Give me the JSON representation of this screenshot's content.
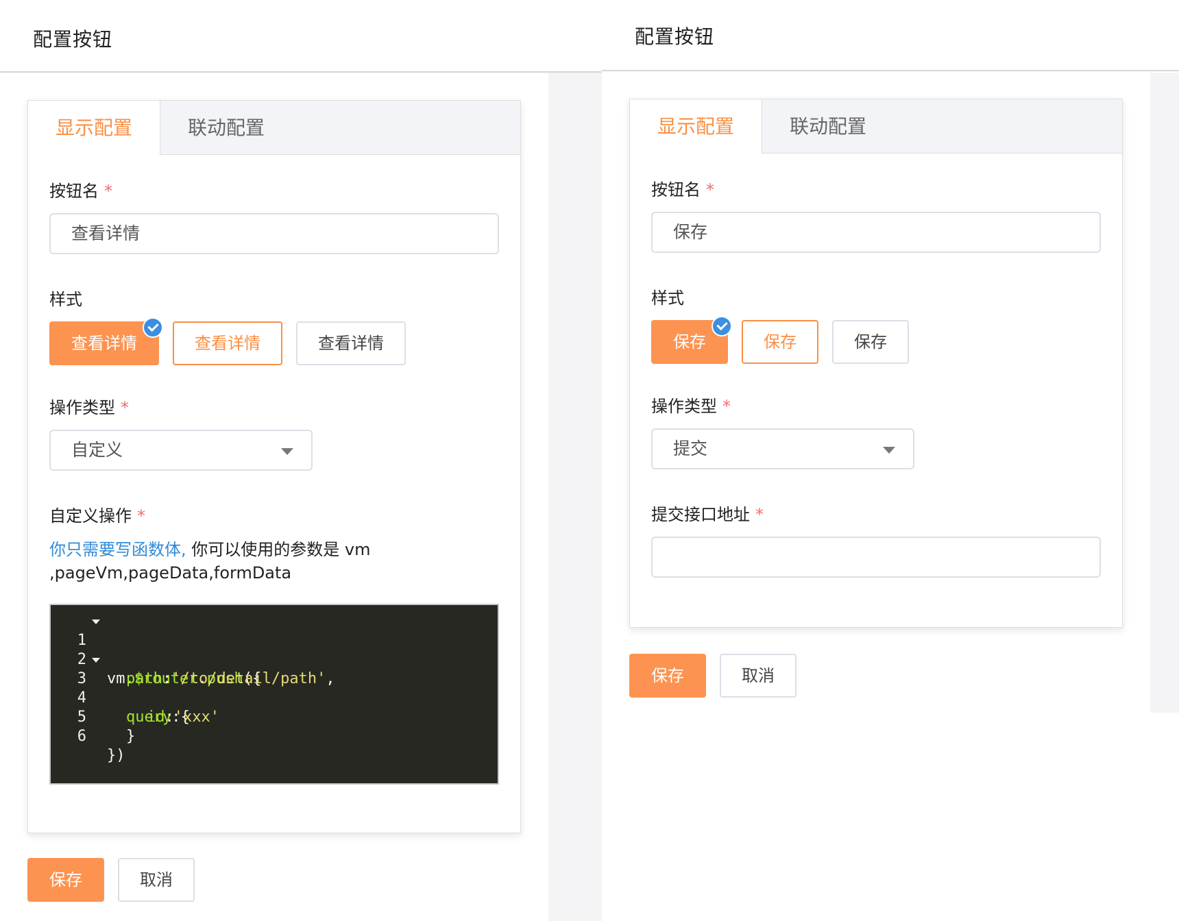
{
  "left_panel": {
    "title": "配置按钮",
    "tabs": [
      {
        "label": "显示配置"
      },
      {
        "label": "联动配置"
      }
    ],
    "button_name": {
      "label": "按钮名",
      "required": "*",
      "value": "查看详情"
    },
    "style": {
      "label": "样式",
      "options": [
        {
          "label": "查看详情"
        },
        {
          "label": "查看详情"
        },
        {
          "label": "查看详情"
        }
      ]
    },
    "operation_type": {
      "label": "操作类型",
      "required": "*",
      "value": "自定义"
    },
    "custom_operation": {
      "label": "自定义操作",
      "required": "*",
      "hint_link": "你只需要写函数体,",
      "hint_text": "你可以使用的参数是 vm ,pageVm,pageData,formData"
    },
    "code": {
      "lines": [
        {
          "n": "1",
          "t1": "vm.",
          "t2": "$router",
          "t3": ".",
          "t4": "push",
          "t5": "({"
        },
        {
          "n": "2",
          "key": "path",
          "sep": ":",
          "str": "'/to/detail/path'",
          "end": ","
        },
        {
          "n": "3",
          "key": "query",
          "sep": ":",
          "end": "{"
        },
        {
          "n": "4",
          "key": "id",
          "sep": ":",
          "str": "'xxx'"
        },
        {
          "n": "5",
          "text": "}"
        },
        {
          "n": "6",
          "text": "})"
        }
      ]
    },
    "actions": {
      "save": "保存",
      "cancel": "取消"
    }
  },
  "right_panel": {
    "title": "配置按钮",
    "tabs": [
      {
        "label": "显示配置"
      },
      {
        "label": "联动配置"
      }
    ],
    "button_name": {
      "label": "按钮名",
      "required": "*",
      "value": "保存"
    },
    "style": {
      "label": "样式",
      "options": [
        {
          "label": "保存"
        },
        {
          "label": "保存"
        },
        {
          "label": "保存"
        }
      ]
    },
    "operation_type": {
      "label": "操作类型",
      "required": "*",
      "value": "提交"
    },
    "submit_url": {
      "label": "提交接口地址",
      "required": "*",
      "value": ""
    },
    "actions": {
      "save": "保存",
      "cancel": "取消"
    }
  },
  "colors": {
    "accent": "#fb8f43",
    "accent_fill": "#fc9351",
    "required": "#f56c6c",
    "hint_link": "#2f8bd8",
    "check_badge": "#3b8fe0",
    "editor_bg": "#272822"
  }
}
